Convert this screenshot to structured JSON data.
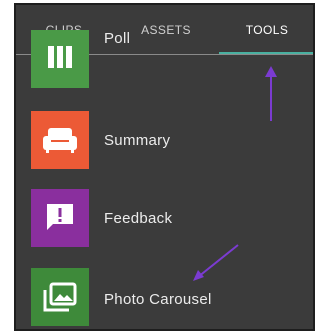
{
  "tabs": [
    {
      "label": "CLIPS",
      "active": false
    },
    {
      "label": "ASSETS",
      "active": false
    },
    {
      "label": "TOOLS",
      "active": true
    }
  ],
  "tools": [
    {
      "label": "Poll",
      "icon": "poll-icon",
      "color": "#4a9a47"
    },
    {
      "label": "Summary",
      "icon": "sofa-icon",
      "color": "#ec5a36"
    },
    {
      "label": "Feedback",
      "icon": "feedback-icon",
      "color": "#8a2f9e"
    },
    {
      "label": "Photo Carousel",
      "icon": "photo-carousel-icon",
      "color": "#3e8a3a"
    }
  ],
  "colors": {
    "panel_background": "#3b3b3b",
    "active_tab_underline": "#49b0a0",
    "annotation_arrow": "#7b3bd1"
  }
}
